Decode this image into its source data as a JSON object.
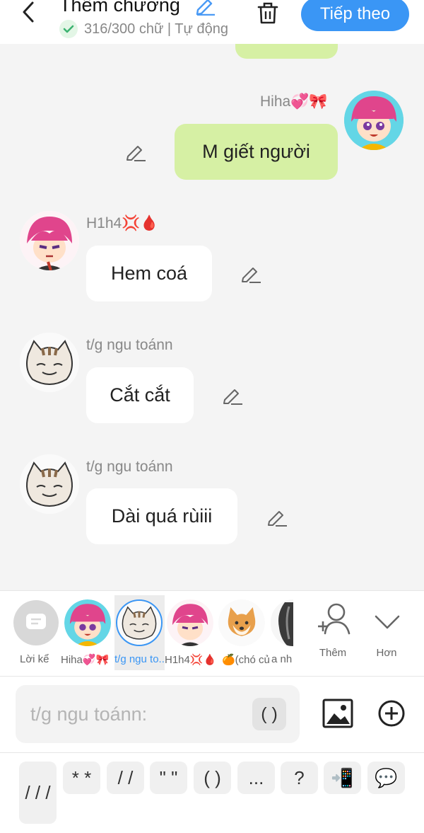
{
  "header": {
    "title": "Thêm chương",
    "status_text": "316/300 chữ | Tự động",
    "next_label": "Tiếp theo"
  },
  "messages": [
    {
      "sender": "Hiha💞🎀",
      "text": "M giết người",
      "side": "right"
    },
    {
      "sender": "H1h4💢🩸",
      "text": "Hem coá",
      "side": "left"
    },
    {
      "sender": "t/g ngu toánn",
      "text": "Cắt cắt",
      "side": "left"
    },
    {
      "sender": "t/g ngu toánn",
      "text": "Dài quá rùiii",
      "side": "left"
    }
  ],
  "characters": [
    {
      "label": "Lời kể"
    },
    {
      "label": "Hiha💞🎀"
    },
    {
      "label": "t/g ngu to..."
    },
    {
      "label": "H1h4💢🩸"
    },
    {
      "label": "🍊(chó củ..."
    },
    {
      "label": "a nh"
    }
  ],
  "actions": {
    "add_label": "Thêm",
    "more_label": "Hơn"
  },
  "input": {
    "placeholder": "t/g ngu toánn:",
    "paren_label": "( )"
  },
  "keys": [
    "/ / /",
    "* *",
    "/ /",
    "\" \"",
    "( )",
    "...",
    "?",
    "📲",
    "💬"
  ],
  "colors": {
    "accent": "#3a96f5",
    "bubble_self": "#d6f0a4",
    "bubble_other": "#ffffff",
    "background": "#f4f4f4"
  }
}
